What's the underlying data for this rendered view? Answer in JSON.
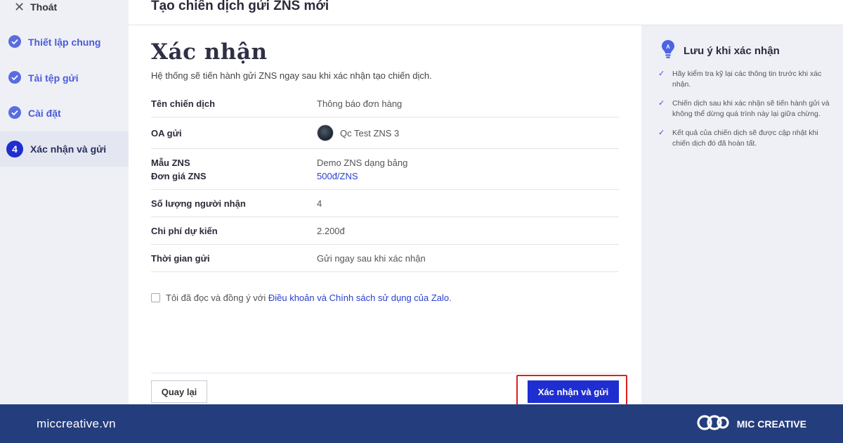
{
  "sidebar": {
    "exit_label": "Thoát",
    "steps": [
      {
        "label": "Thiết lập chung",
        "state": "done"
      },
      {
        "label": "Tải tệp gửi",
        "state": "done"
      },
      {
        "label": "Cài đặt",
        "state": "done"
      },
      {
        "label": "Xác nhận và gửi",
        "state": "active",
        "number": "4"
      }
    ]
  },
  "header": {
    "title": "Tạo chiến dịch gửi ZNS mới"
  },
  "main": {
    "title": "Xác nhận",
    "subtitle": "Hệ thống sẽ tiến hành gửi ZNS ngay sau khi xác nhận tạo chiến dịch.",
    "rows": {
      "campaign_name": {
        "key": "Tên chiến dịch",
        "value": "Thông báo đơn hàng"
      },
      "oa": {
        "key": "OA gửi",
        "value": "Qc Test ZNS 3"
      },
      "template": {
        "key": "Mẫu ZNS",
        "value": "Demo ZNS dạng bảng"
      },
      "price": {
        "key": "Đơn giá ZNS",
        "value": "500đ/ZNS"
      },
      "recipients": {
        "key": "Số lượng người nhận",
        "value": "4"
      },
      "cost": {
        "key": "Chi phí dự kiến",
        "value": "2.200đ"
      },
      "send_time": {
        "key": "Thời gian gửi",
        "value": "Gửi ngay sau khi xác nhận"
      }
    },
    "agree": {
      "prefix": "Tôi đã đọc và đồng ý với",
      "link": "Điều khoản và Chính sách sử dụng của Zalo",
      "suffix": "."
    },
    "back_label": "Quay lại",
    "confirm_label": "Xác nhận và gửi"
  },
  "notes": {
    "title": "Lưu ý khi xác nhận",
    "items": [
      "Hãy kiểm tra kỹ lại các thông tin trước khi xác nhận.",
      "Chiến dịch sau khi xác nhận sẽ tiến hành gửi và không thể dừng quá trình này lại giữa chừng.",
      "Kết quả của chiến dịch sẽ được cập nhật khi chiến dịch đó đã hoàn tất."
    ]
  },
  "banner": {
    "site": "miccreative.vn",
    "brand": "MIC CREATIVE"
  },
  "colors": {
    "primary": "#1f2ed0",
    "banner": "#243d7c",
    "highlight": "#e02020",
    "sidebar_bg": "#eef0f6"
  },
  "icons": [
    "close-icon",
    "check-circle-icon",
    "lightbulb-icon",
    "check-icon",
    "mic-logo-icon"
  ]
}
